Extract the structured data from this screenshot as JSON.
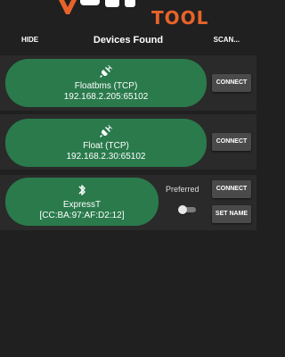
{
  "logo": {
    "text": "TOOL",
    "color": "#e8632a"
  },
  "header": {
    "hide_label": "HIDE",
    "title": "Devices Found",
    "scan_label": "SCAN..."
  },
  "devices": [
    {
      "icon": "plug-icon",
      "name": "Floatbms (TCP)",
      "address": "192.168.2.205:65102",
      "connect_label": "CONNECT"
    },
    {
      "icon": "plug-icon",
      "name": "Float (TCP)",
      "address": "192.168.2.30:65102",
      "connect_label": "CONNECT"
    },
    {
      "icon": "bluetooth-icon",
      "name": "ExpressT",
      "address": "[CC:BA:97:AF:D2:12]",
      "connect_label": "CONNECT",
      "preferred_label": "Preferred",
      "preferred": false,
      "set_name_label": "SET NAME"
    }
  ],
  "colors": {
    "background": "#202020",
    "row": "#2a2a2a",
    "pill": "#2a7a4c",
    "button": "#4a4a4a"
  }
}
